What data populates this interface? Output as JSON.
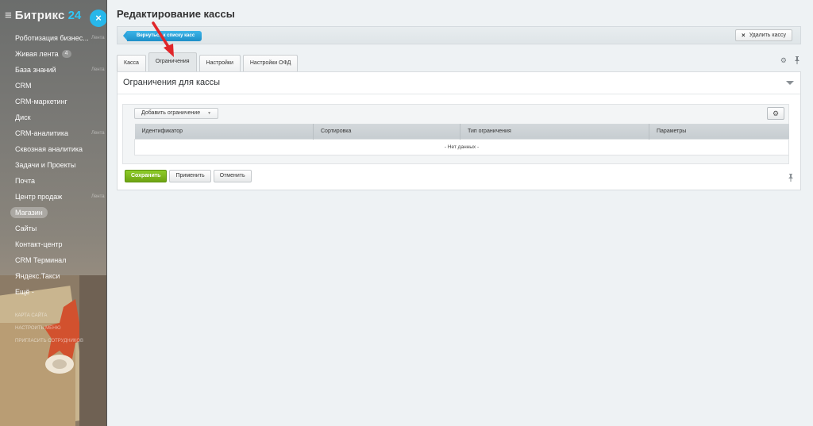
{
  "sidebar": {
    "logo_part1": "Битрикс",
    "logo_part2": "24",
    "close_glyph": "×",
    "items": [
      {
        "label": "Роботизация бизнес...",
        "ghost": "Лента"
      },
      {
        "label": "Живая лента",
        "counter": "4"
      },
      {
        "label": "База знаний",
        "ghost": "Лента"
      },
      {
        "label": "CRM"
      },
      {
        "label": "CRM-маркетинг"
      },
      {
        "label": "Диск"
      },
      {
        "label": "CRM-аналитика",
        "ghost": "Лента"
      },
      {
        "label": "Сквозная аналитика"
      },
      {
        "label": "Задачи и Проекты"
      },
      {
        "label": "Почта"
      },
      {
        "label": "Центр продаж",
        "ghost": "Лента"
      },
      {
        "label": "Магазин",
        "active": true
      },
      {
        "label": "Сайты"
      },
      {
        "label": "Контакт-центр"
      },
      {
        "label": "CRM Терминал"
      },
      {
        "label": "Яндекс.Такси"
      },
      {
        "label": "Ещё -"
      }
    ],
    "small_links": [
      "Карта сайта",
      "Настроить меню",
      "Пригласить сотрудников"
    ]
  },
  "header": {
    "title": "Редактирование кассы"
  },
  "toolbar": {
    "back_label": "Вернуться к списку касс",
    "delete_label": "Удалить кассу",
    "delete_icon": "×"
  },
  "tabs": [
    {
      "label": "Касса",
      "active": false
    },
    {
      "label": "Ограничения",
      "active": true
    },
    {
      "label": "Настройки",
      "active": false
    },
    {
      "label": "Настройки ОФД",
      "active": false
    }
  ],
  "tab_icons": {
    "settings": "⚙",
    "pin": "📌"
  },
  "panel": {
    "title": "Ограничения для кассы",
    "add_button": "Добавить ограничение",
    "add_caret": "▼",
    "settings_glyph": "⚙",
    "columns": [
      "Идентификатор",
      "Сортировка",
      "Тип ограничения",
      "Параметры"
    ],
    "empty_text": "- Нет данных -"
  },
  "actions": {
    "save": "Сохранить",
    "apply": "Применить",
    "cancel": "Отменить",
    "pin_glyph": "📌"
  },
  "colors": {
    "accent": "#2fc6f6",
    "save_green": "#7cb51b",
    "back_blue": "#2a9fd8",
    "annotation_arrow": "#e0262a"
  }
}
